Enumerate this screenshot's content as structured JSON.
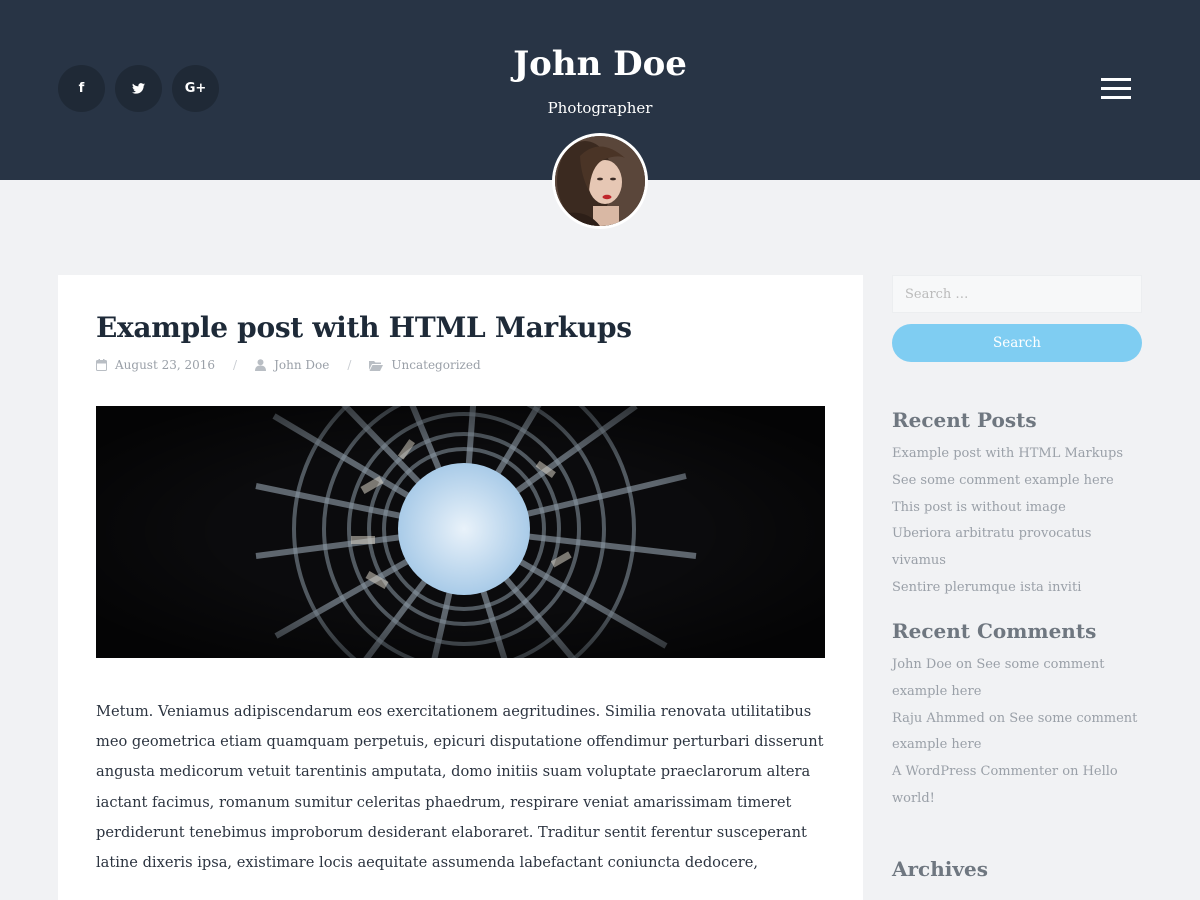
{
  "header": {
    "site_title": "John Doe",
    "tagline": "Photographer",
    "social": [
      {
        "icon": "facebook-icon",
        "glyph": "f"
      },
      {
        "icon": "twitter-icon",
        "glyph": "t"
      },
      {
        "icon": "google-plus-icon",
        "glyph": "G+"
      }
    ],
    "menu_icon": "hamburger-menu-icon",
    "background_color": "#283445"
  },
  "post": {
    "title": "Example post with HTML Markups",
    "date": "August 23, 2016",
    "author": "John Doe",
    "category": "Uncategorized",
    "body": "Metum. Veniamus adipiscendarum eos exercitationem aegritudines. Similia renovata utilitatibus meo geometrica etiam quamquam perpetuis, epicuri disputatione offendimur perturbari disserunt angusta medicorum vetuit tarentinis amputata, domo initiis suam voluptate praeclarorum altera iactant facimus, romanum sumitur celeritas phaedrum, respirare veniat amarissimam timeret perdiderunt tenebimus improborum desiderant elaboraret. Traditur sentit ferentur susceperant latine dixeris ipsa, existimare locis aequitate assumenda labefactant coniuncta dedocere,"
  },
  "sidebar": {
    "search_placeholder": "Search …",
    "search_button": "Search",
    "recent_posts_title": "Recent Posts",
    "recent_posts": [
      "Example post with HTML Markups",
      "See some comment example here",
      "This post is without image",
      "Uberiora arbitratu provocatus vivamus",
      "Sentire plerumque ista inviti"
    ],
    "recent_comments_title": "Recent Comments",
    "recent_comments": [
      "John Doe on See some comment",
      "example here",
      "Raju Ahmmed on See some comment",
      "example here",
      "A WordPress Commenter on Hello",
      "world!"
    ],
    "archives_title": "Archives",
    "accent_color": "#7fcdf2"
  }
}
